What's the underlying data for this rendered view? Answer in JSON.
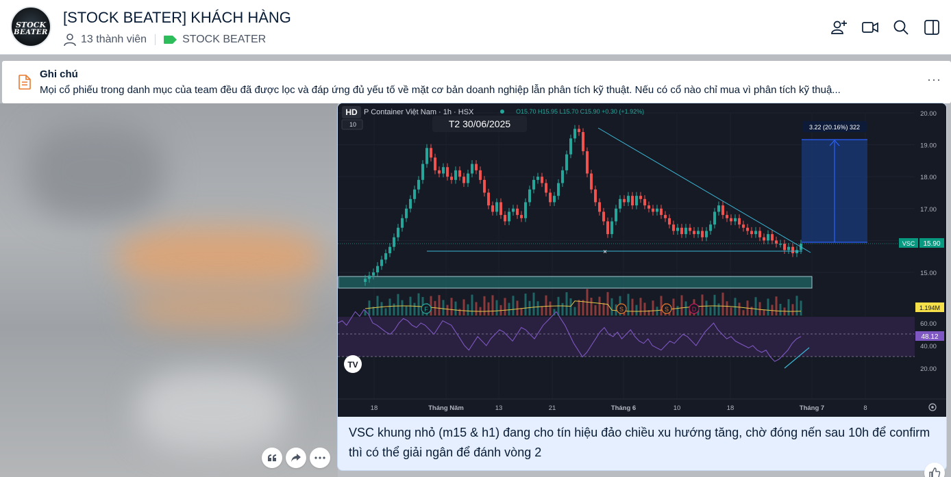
{
  "group": {
    "avatar_line1": "STOCK",
    "avatar_line2": "BEATER",
    "title": "[STOCK BEATER] KHÁCH HÀNG",
    "members": "13 thành viên",
    "tag": "STOCK BEATER",
    "tag_color": "#2dbd5a"
  },
  "header_icons": [
    "add-member-icon",
    "video-call-icon",
    "search-icon",
    "sidebar-toggle-icon"
  ],
  "note": {
    "title": "Ghi chú",
    "text": "Mọi cổ phiếu trong danh mục của team đều đã được lọc và đáp ứng đủ yếu tố về mặt cơ bản doanh nghiệp lẫn phân tích kỹ thuật. Nếu có cổ nào chỉ mua vì phân tích kỹ thuậ...",
    "more": "···",
    "icon_color": "#e8792b"
  },
  "chart_data": {
    "type": "candlestick",
    "quality_badge": "HD",
    "symbol_title": "P Container Việt Nam · 1h · HSX",
    "ohlc": "O15.70 H15.95 L15.70 C15.90 +0.30 (+1.92%)",
    "interval_badge": "10",
    "date_tooltip": "T2 30/06/2025",
    "measure_label": "3.22 (20.16%) 322",
    "price_ticks": [
      "20.00",
      "19.00",
      "18.00",
      "17.00",
      "16.00",
      "15.00"
    ],
    "ylim": [
      14.5,
      20.2
    ],
    "rsi_ticks": [
      "60.00",
      "40.00",
      "20.00"
    ],
    "x_ticks": [
      "18",
      "Tháng Năm",
      "13",
      "21",
      "Tháng 6",
      "10",
      "18",
      "Tháng 7",
      "8"
    ],
    "last_price_symbol": "VSC",
    "last_price": "15.90",
    "volume_label": "1.194M",
    "rsi_value": "48.12",
    "event_markers": [
      "F",
      "S",
      "S",
      "D"
    ],
    "close_series": [
      14.8,
      14.9,
      15.0,
      15.2,
      15.4,
      15.6,
      15.8,
      16.1,
      16.4,
      16.7,
      17.0,
      17.3,
      17.6,
      17.9,
      18.4,
      18.9,
      18.6,
      18.2,
      18.1,
      18.3,
      18.0,
      17.9,
      18.2,
      18.0,
      17.8,
      18.1,
      18.4,
      18.2,
      17.9,
      17.5,
      17.1,
      16.9,
      17.2,
      16.8,
      16.6,
      16.9,
      17.0,
      16.8,
      16.7,
      17.2,
      17.6,
      17.9,
      18.0,
      17.8,
      17.5,
      17.2,
      17.4,
      17.8,
      18.2,
      18.7,
      19.2,
      19.5,
      19.4,
      18.8,
      18.1,
      17.6,
      17.2,
      16.9,
      16.6,
      16.2,
      16.6,
      17.0,
      17.3,
      17.2,
      17.4,
      17.1,
      17.4,
      17.3,
      17.1,
      17.0,
      16.9,
      17.0,
      16.8,
      16.7,
      16.5,
      16.3,
      16.4,
      16.2,
      16.4,
      16.3,
      16.2,
      16.3,
      16.1,
      16.3,
      16.5,
      16.9,
      17.1,
      16.8,
      16.7,
      16.6,
      16.7,
      16.5,
      16.4,
      16.3,
      16.2,
      16.3,
      16.1,
      16.0,
      16.2,
      16.0,
      15.9,
      15.9,
      15.7,
      15.8,
      15.6,
      15.7,
      15.9
    ],
    "rsi_series": [
      60,
      62,
      58,
      64,
      70,
      66,
      72,
      68,
      60,
      58,
      55,
      52,
      50,
      54,
      60,
      64,
      62,
      58,
      56,
      60,
      58,
      54,
      50,
      56,
      62,
      60,
      58,
      52,
      46,
      40,
      36,
      42,
      48,
      44,
      40,
      46,
      50,
      54,
      52,
      48,
      44,
      50,
      56,
      54,
      50,
      46,
      52,
      58,
      62,
      66,
      70,
      64,
      58,
      50,
      42,
      36,
      30,
      34,
      40,
      46,
      52,
      56,
      50,
      48,
      52,
      46,
      50,
      54,
      48,
      44,
      42,
      46,
      40,
      38,
      36,
      40,
      44,
      42,
      46,
      50,
      48,
      44,
      40,
      46,
      52,
      56,
      60,
      54,
      50,
      46,
      48,
      44,
      42,
      40,
      38,
      40,
      36,
      34,
      36,
      30,
      26,
      28,
      32,
      36,
      42,
      46,
      48
    ],
    "colors": {
      "up": "#26a69a",
      "down": "#ef5350",
      "background": "#161a25",
      "trendline": "#3bb8d6",
      "measure": "#2962ff",
      "rsi": "#7e57c2",
      "volume_ma": "#e6c84a"
    }
  },
  "message": {
    "caption": "VSC khung nhỏ (m15 & h1) đang cho tín hiệu đảo chiều xu hướng tăng, chờ đóng nến sau 10h để confirm thì có thể giải ngân để đánh vòng 2"
  },
  "actions": [
    "quote-icon",
    "share-icon",
    "more-icon",
    "like-icon"
  ]
}
